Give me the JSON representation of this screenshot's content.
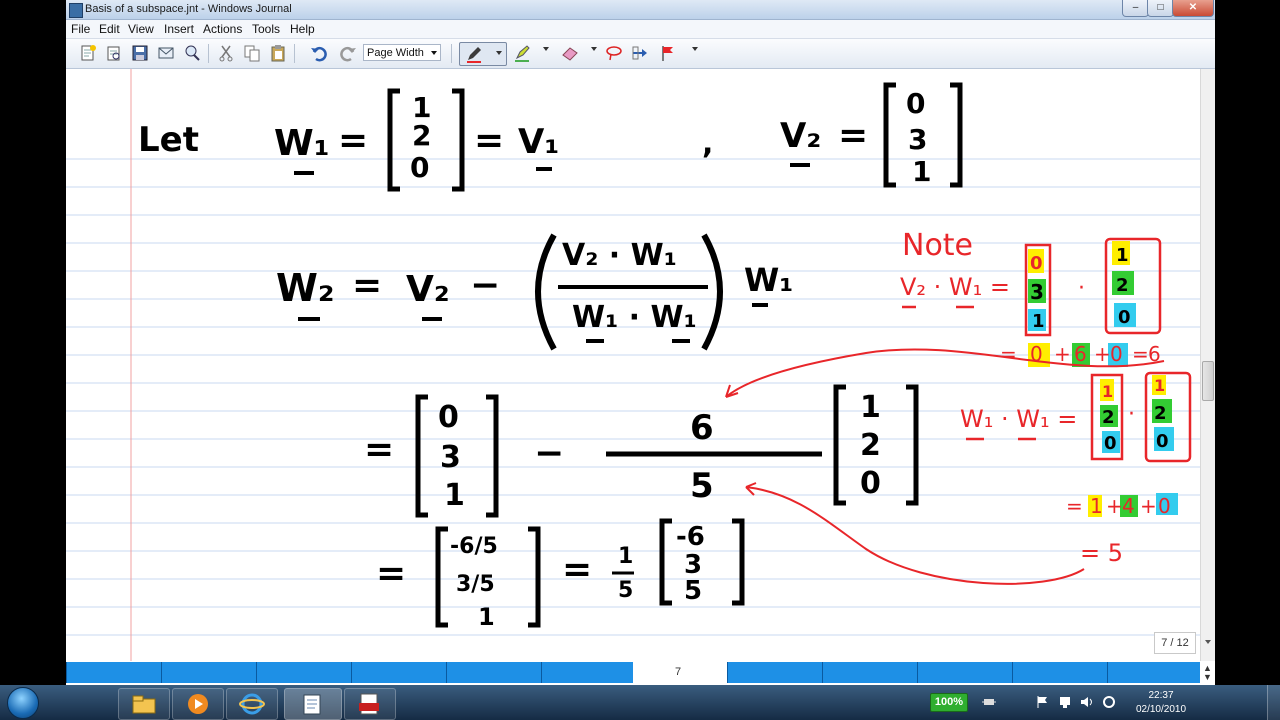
{
  "window": {
    "title": "Basis of a subspace.jnt - Windows Journal",
    "controls": {
      "minimize": "–",
      "maximize": "□",
      "close": "✕"
    }
  },
  "menu": [
    "File",
    "Edit",
    "View",
    "Insert",
    "Actions",
    "Tools",
    "Help"
  ],
  "toolbar": {
    "zoom_value": "Page Width",
    "icons": [
      "new-note-icon",
      "open-icon",
      "save-icon",
      "send-icon",
      "find-icon",
      "cut-icon",
      "copy-icon",
      "paste-icon",
      "undo-icon",
      "redo-icon",
      "pen-icon",
      "highlighter-icon",
      "eraser-icon",
      "lasso-icon",
      "insert-space-icon",
      "flag-icon"
    ]
  },
  "note": {
    "ink_color": "#000000",
    "annotation_color": "#e8262a",
    "highlight_yellow": "#ffee00",
    "highlight_green": "#33cc33",
    "highlight_cyan": "#33ccee",
    "rule_color": "#c8d8f0",
    "margin_color": "#f0a0a0",
    "handwriting": {
      "line1": {
        "let": "Let",
        "w1": "W₁",
        "eq": "=",
        "vec_w1": [
          "1",
          "2",
          "0"
        ],
        "v1": "V₁",
        "comma": ",",
        "v2": "V₂",
        "vec_v2": [
          "0",
          "3",
          "1"
        ]
      },
      "line2": {
        "w2": "W₂",
        "eq": "=",
        "v2": "V₂",
        "minus": "−",
        "num": "V₂ · W₁",
        "den": "W₁ · W₁",
        "w1": "W₁"
      },
      "line3": {
        "eq": "=",
        "vec_a": [
          "0",
          "3",
          "1"
        ],
        "minus": "−",
        "num": "6",
        "den": "5",
        "vec_b": [
          "1",
          "2",
          "0"
        ]
      },
      "line4": {
        "eq": "=",
        "vec_c": [
          "-6/5",
          "3/5",
          "1"
        ],
        "eq2": "=",
        "frac_num": "1",
        "frac_den": "5",
        "vec_d": [
          "-6",
          "3",
          "5"
        ]
      },
      "note_title": "Note",
      "note_dot1": {
        "left": "V₂ · W₁ =",
        "vec_a": [
          "0",
          "3",
          "1"
        ],
        "dot": "·",
        "vec_b": [
          "1",
          "2",
          "0"
        ],
        "sum": [
          "=",
          "0",
          "+",
          "6",
          "+",
          "0",
          "=",
          "6"
        ]
      },
      "note_dot2": {
        "left": "W₁ · W₁ =",
        "vec_a": [
          "1",
          "2",
          "0"
        ],
        "dot": "·",
        "vec_b": [
          "1",
          "2",
          "0"
        ],
        "sum": [
          "=",
          "1",
          "+",
          "4",
          "+",
          "0"
        ],
        "result": "= 5"
      }
    }
  },
  "page_indicator": "7 / 12",
  "page_number": "7",
  "taskbar": {
    "apps": [
      "file-explorer-icon",
      "media-player-icon",
      "internet-explorer-icon",
      "windows-journal-icon",
      "pdf-icon"
    ],
    "battery": "100%",
    "time": "22:37",
    "date": "02/10/2010"
  }
}
